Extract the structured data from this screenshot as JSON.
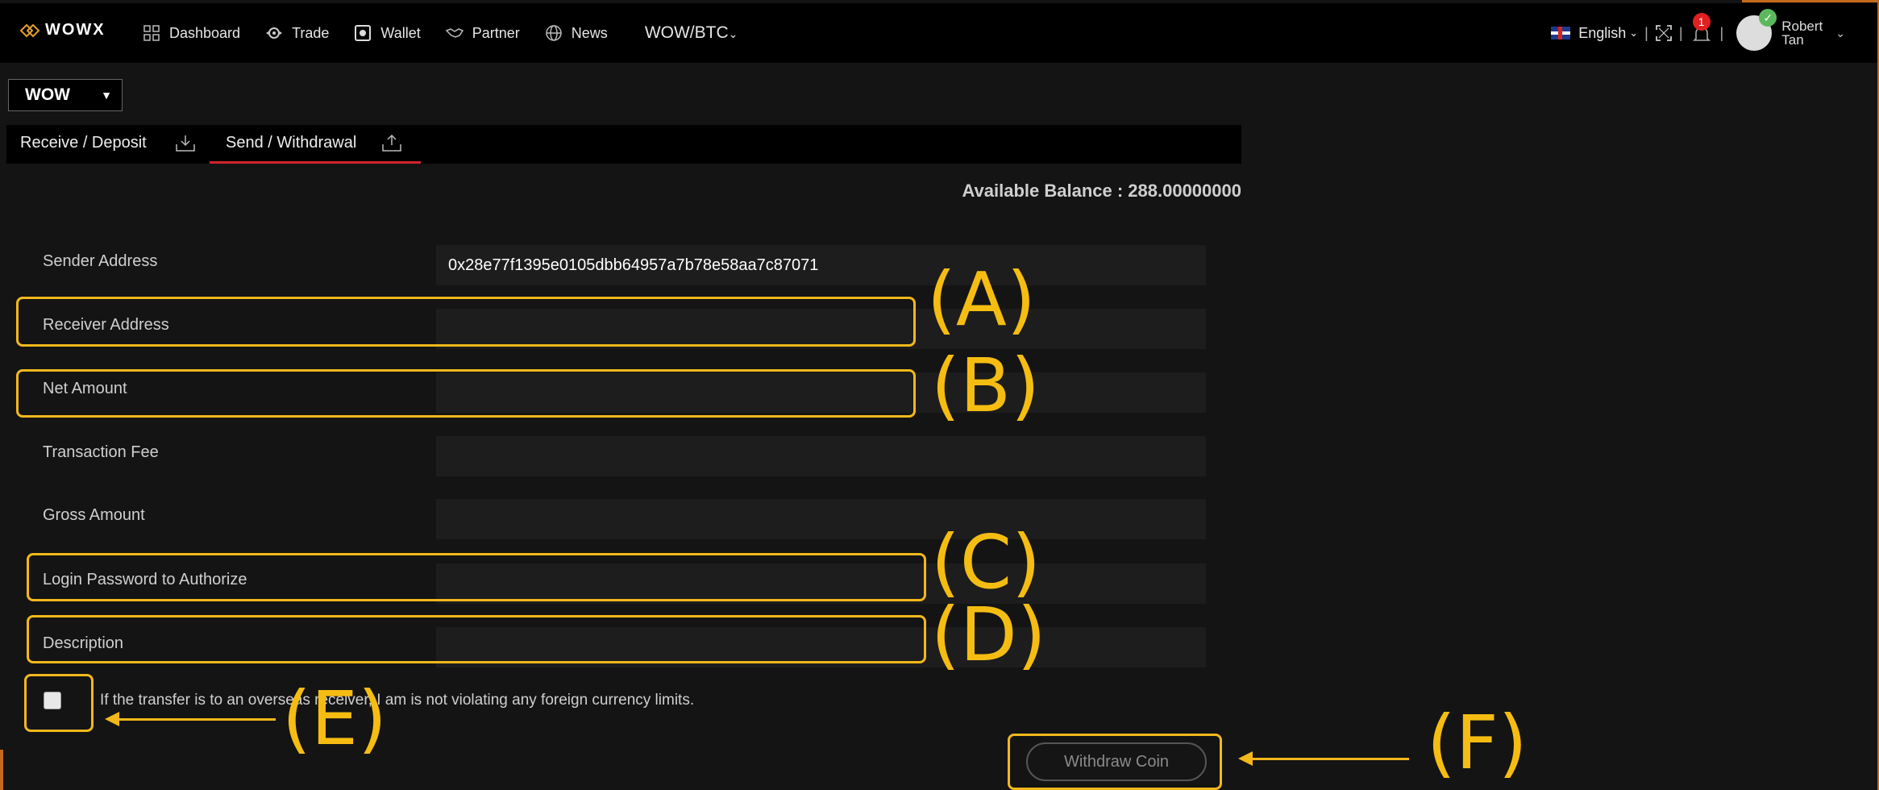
{
  "nav": {
    "logo": "WOWX",
    "items": [
      {
        "label": "Dashboard",
        "icon": "dashboard-icon"
      },
      {
        "label": "Trade",
        "icon": "trade-icon"
      },
      {
        "label": "Wallet",
        "icon": "wallet-icon"
      },
      {
        "label": "Partner",
        "icon": "handshake-icon"
      },
      {
        "label": "News",
        "icon": "globe-icon"
      }
    ],
    "pair": "WOW/BTC",
    "language": "English",
    "notification_count": "1",
    "user_first": "Robert",
    "user_last": "Tan"
  },
  "coin_select": {
    "value": "WOW"
  },
  "tabs": [
    {
      "label": "Receive / Deposit",
      "active": false
    },
    {
      "label": "Send / Withdrawal",
      "active": true
    }
  ],
  "balance": "Available Balance : 288.00000000",
  "form": {
    "sender_label": "Sender Address",
    "sender_value": "0x28e77f1395e0105dbb64957a7b78e58aa7c87071",
    "receiver_label": "Receiver Address",
    "receiver_value": "",
    "net_label": "Net Amount",
    "net_value": "",
    "fee_label": "Transaction Fee",
    "fee_value": "",
    "gross_label": "Gross Amount",
    "gross_value": "",
    "password_label": "Login Password to Authorize",
    "password_value": "",
    "description_label": "Description",
    "description_value": "",
    "checkbox_text": "If the transfer is to an overseas receiver, I am is not violating any foreign currency limits.",
    "checkbox_checked": false,
    "submit_label": "Withdraw Coin"
  },
  "annotations": {
    "a": "(A)",
    "b": "(B)",
    "c": "(C)",
    "d": "(D)",
    "e": "(E)",
    "f": "(F)"
  },
  "colors": {
    "highlight": "#f2b81b",
    "active_tab_underline": "#d0252b",
    "background": "#141414"
  }
}
